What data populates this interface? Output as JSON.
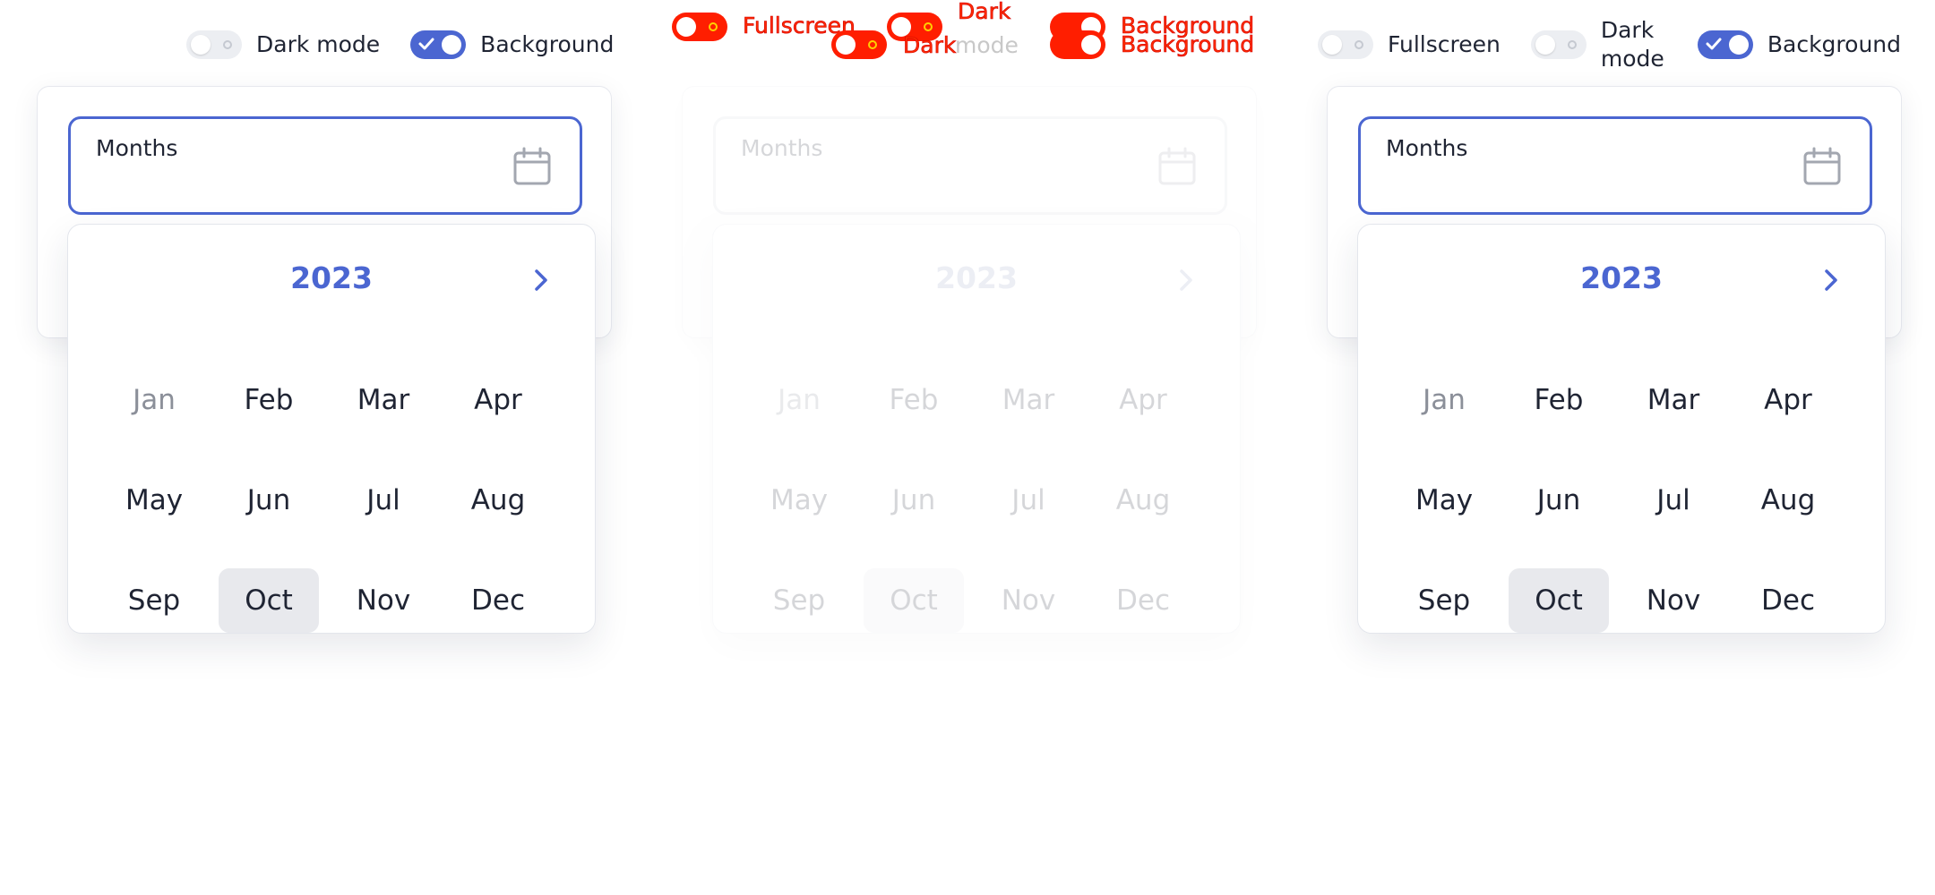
{
  "colors": {
    "accent": "#4b66d1",
    "text": "#1f2433",
    "muted": "#8b8f99",
    "selected_bg": "#e8e9ed",
    "glitch_red": "#ff1e00"
  },
  "left": {
    "toolbar": {
      "dark_mode_label": "Dark mode",
      "background_label": "Background",
      "dark_mode_on": false,
      "background_on": true
    },
    "field_label": "Months",
    "year": "2023",
    "months": [
      "Jan",
      "Feb",
      "Mar",
      "Apr",
      "May",
      "Jun",
      "Jul",
      "Aug",
      "Sep",
      "Oct",
      "Nov",
      "Dec"
    ],
    "selected_month": "Oct",
    "muted_month": "Jan"
  },
  "middle": {
    "overlay": {
      "fullscreen_label": "Fullscreen",
      "dark_label": "Dark",
      "mode_label": "mode",
      "background_label": "Background"
    },
    "field_label": "Months",
    "year": "2023",
    "months": [
      "Jan",
      "Feb",
      "Mar",
      "Apr",
      "May",
      "Jun",
      "Jul",
      "Aug",
      "Sep",
      "Oct",
      "Nov",
      "Dec"
    ]
  },
  "right": {
    "toolbar": {
      "fullscreen_label": "Fullscreen",
      "dark_mode_label": "Dark mode",
      "background_label": "Background",
      "fullscreen_on": false,
      "dark_mode_on": false,
      "background_on": true
    },
    "field_label": "Months",
    "year": "2023",
    "months": [
      "Jan",
      "Feb",
      "Mar",
      "Apr",
      "May",
      "Jun",
      "Jul",
      "Aug",
      "Sep",
      "Oct",
      "Nov",
      "Dec"
    ],
    "selected_month": "Oct",
    "muted_month": "Jan"
  }
}
